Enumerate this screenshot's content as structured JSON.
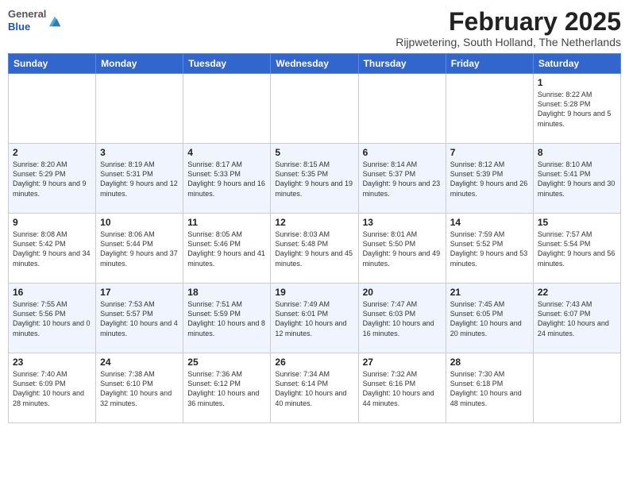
{
  "logo": {
    "general": "General",
    "blue": "Blue"
  },
  "header": {
    "month": "February 2025",
    "location": "Rijpwetering, South Holland, The Netherlands"
  },
  "weekdays": [
    "Sunday",
    "Monday",
    "Tuesday",
    "Wednesday",
    "Thursday",
    "Friday",
    "Saturday"
  ],
  "weeks": [
    [
      {
        "day": "",
        "info": ""
      },
      {
        "day": "",
        "info": ""
      },
      {
        "day": "",
        "info": ""
      },
      {
        "day": "",
        "info": ""
      },
      {
        "day": "",
        "info": ""
      },
      {
        "day": "",
        "info": ""
      },
      {
        "day": "1",
        "info": "Sunrise: 8:22 AM\nSunset: 5:28 PM\nDaylight: 9 hours and 5 minutes."
      }
    ],
    [
      {
        "day": "2",
        "info": "Sunrise: 8:20 AM\nSunset: 5:29 PM\nDaylight: 9 hours and 9 minutes."
      },
      {
        "day": "3",
        "info": "Sunrise: 8:19 AM\nSunset: 5:31 PM\nDaylight: 9 hours and 12 minutes."
      },
      {
        "day": "4",
        "info": "Sunrise: 8:17 AM\nSunset: 5:33 PM\nDaylight: 9 hours and 16 minutes."
      },
      {
        "day": "5",
        "info": "Sunrise: 8:15 AM\nSunset: 5:35 PM\nDaylight: 9 hours and 19 minutes."
      },
      {
        "day": "6",
        "info": "Sunrise: 8:14 AM\nSunset: 5:37 PM\nDaylight: 9 hours and 23 minutes."
      },
      {
        "day": "7",
        "info": "Sunrise: 8:12 AM\nSunset: 5:39 PM\nDaylight: 9 hours and 26 minutes."
      },
      {
        "day": "8",
        "info": "Sunrise: 8:10 AM\nSunset: 5:41 PM\nDaylight: 9 hours and 30 minutes."
      }
    ],
    [
      {
        "day": "9",
        "info": "Sunrise: 8:08 AM\nSunset: 5:42 PM\nDaylight: 9 hours and 34 minutes."
      },
      {
        "day": "10",
        "info": "Sunrise: 8:06 AM\nSunset: 5:44 PM\nDaylight: 9 hours and 37 minutes."
      },
      {
        "day": "11",
        "info": "Sunrise: 8:05 AM\nSunset: 5:46 PM\nDaylight: 9 hours and 41 minutes."
      },
      {
        "day": "12",
        "info": "Sunrise: 8:03 AM\nSunset: 5:48 PM\nDaylight: 9 hours and 45 minutes."
      },
      {
        "day": "13",
        "info": "Sunrise: 8:01 AM\nSunset: 5:50 PM\nDaylight: 9 hours and 49 minutes."
      },
      {
        "day": "14",
        "info": "Sunrise: 7:59 AM\nSunset: 5:52 PM\nDaylight: 9 hours and 53 minutes."
      },
      {
        "day": "15",
        "info": "Sunrise: 7:57 AM\nSunset: 5:54 PM\nDaylight: 9 hours and 56 minutes."
      }
    ],
    [
      {
        "day": "16",
        "info": "Sunrise: 7:55 AM\nSunset: 5:56 PM\nDaylight: 10 hours and 0 minutes."
      },
      {
        "day": "17",
        "info": "Sunrise: 7:53 AM\nSunset: 5:57 PM\nDaylight: 10 hours and 4 minutes."
      },
      {
        "day": "18",
        "info": "Sunrise: 7:51 AM\nSunset: 5:59 PM\nDaylight: 10 hours and 8 minutes."
      },
      {
        "day": "19",
        "info": "Sunrise: 7:49 AM\nSunset: 6:01 PM\nDaylight: 10 hours and 12 minutes."
      },
      {
        "day": "20",
        "info": "Sunrise: 7:47 AM\nSunset: 6:03 PM\nDaylight: 10 hours and 16 minutes."
      },
      {
        "day": "21",
        "info": "Sunrise: 7:45 AM\nSunset: 6:05 PM\nDaylight: 10 hours and 20 minutes."
      },
      {
        "day": "22",
        "info": "Sunrise: 7:43 AM\nSunset: 6:07 PM\nDaylight: 10 hours and 24 minutes."
      }
    ],
    [
      {
        "day": "23",
        "info": "Sunrise: 7:40 AM\nSunset: 6:09 PM\nDaylight: 10 hours and 28 minutes."
      },
      {
        "day": "24",
        "info": "Sunrise: 7:38 AM\nSunset: 6:10 PM\nDaylight: 10 hours and 32 minutes."
      },
      {
        "day": "25",
        "info": "Sunrise: 7:36 AM\nSunset: 6:12 PM\nDaylight: 10 hours and 36 minutes."
      },
      {
        "day": "26",
        "info": "Sunrise: 7:34 AM\nSunset: 6:14 PM\nDaylight: 10 hours and 40 minutes."
      },
      {
        "day": "27",
        "info": "Sunrise: 7:32 AM\nSunset: 6:16 PM\nDaylight: 10 hours and 44 minutes."
      },
      {
        "day": "28",
        "info": "Sunrise: 7:30 AM\nSunset: 6:18 PM\nDaylight: 10 hours and 48 minutes."
      },
      {
        "day": "",
        "info": ""
      }
    ]
  ]
}
